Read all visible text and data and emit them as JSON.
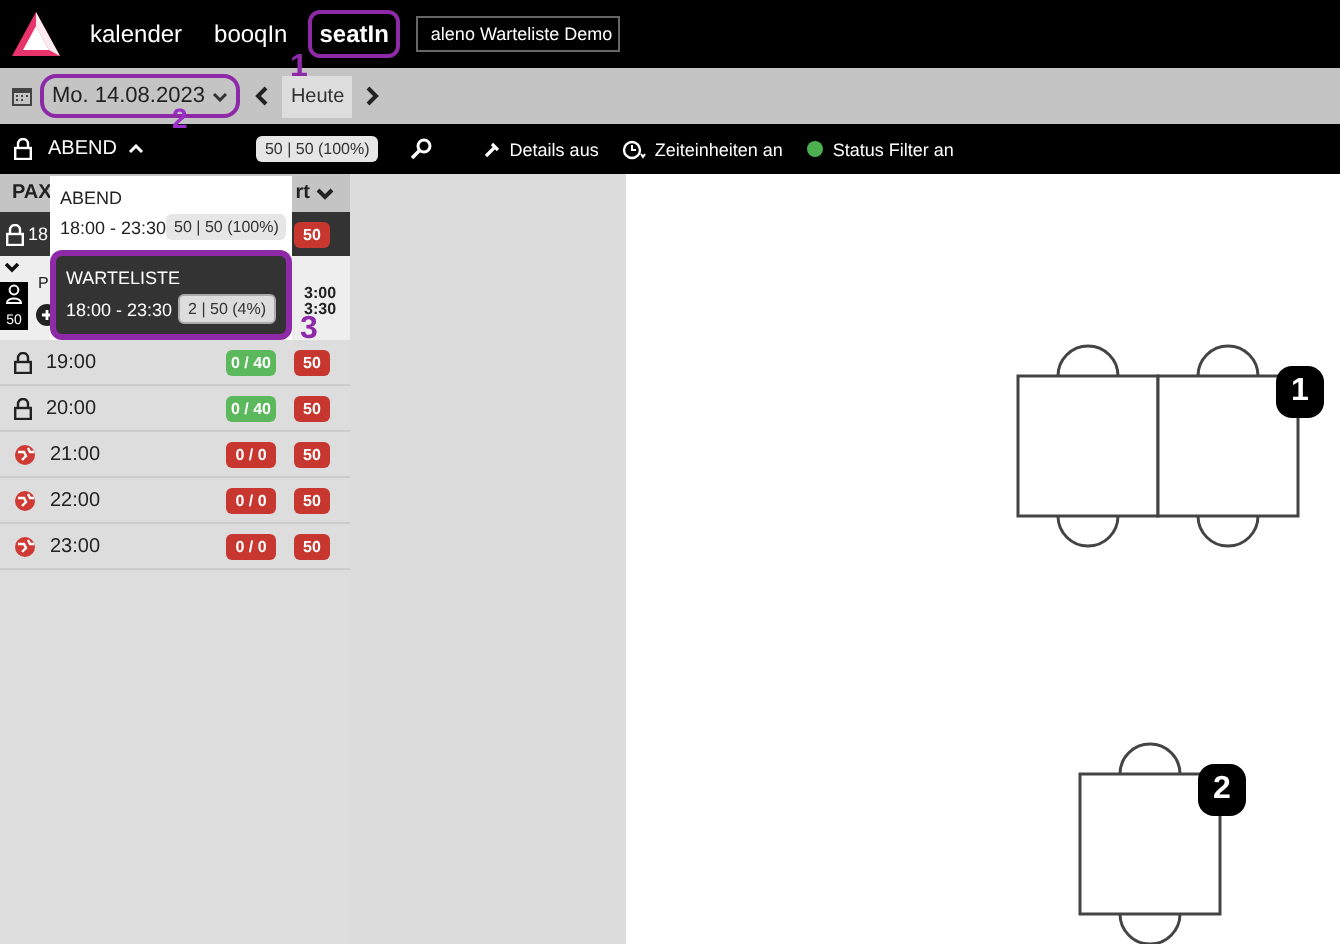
{
  "nav": {
    "items": [
      {
        "label": "kalender",
        "selected": false
      },
      {
        "label": "booqIn",
        "selected": false
      },
      {
        "label": "seatIn",
        "selected": true,
        "callout": "1"
      }
    ],
    "venue": "aleno Warteliste Demo"
  },
  "datebar": {
    "date": "Mo. 14.08.2023",
    "callout": "2",
    "today": "Heute"
  },
  "toolbar": {
    "shift": "ABEND",
    "capacity": "50 | 50 (100%)",
    "options": [
      {
        "kind": "details",
        "label": "Details aus"
      },
      {
        "kind": "time",
        "label": "Zeiteinheiten an"
      },
      {
        "kind": "status",
        "label": "Status Filter an"
      }
    ]
  },
  "shift_menu": [
    {
      "name": "ABEND",
      "time": "18:00 - 23:30",
      "capacity": "50 | 50 (100%)",
      "selected": false
    },
    {
      "name": "WARTELISTE",
      "time": "18:00 - 23:30",
      "capacity": "2 | 50 (4%)",
      "selected": true,
      "callout": "3"
    }
  ],
  "list": {
    "header": {
      "pax": "PAX",
      "column_2": "rt"
    },
    "first_row": {
      "time": "18",
      "count": "50"
    },
    "detail": {
      "pax": "50",
      "label": "P",
      "times": [
        "3:00",
        "3:30"
      ]
    },
    "rows": [
      {
        "time": "19:00",
        "kind": "open",
        "booked": "0 / 40",
        "count": "50"
      },
      {
        "time": "20:00",
        "kind": "open",
        "booked": "0 / 40",
        "count": "50"
      },
      {
        "time": "21:00",
        "kind": "closed",
        "booked": "0 / 0",
        "count": "50"
      },
      {
        "time": "22:00",
        "kind": "closed",
        "booked": "0 / 0",
        "count": "50"
      },
      {
        "time": "23:00",
        "kind": "closed",
        "booked": "0 / 0",
        "count": "50"
      }
    ]
  },
  "tables": [
    {
      "number": "1",
      "kind": "double"
    },
    {
      "number": "2",
      "kind": "single"
    }
  ]
}
